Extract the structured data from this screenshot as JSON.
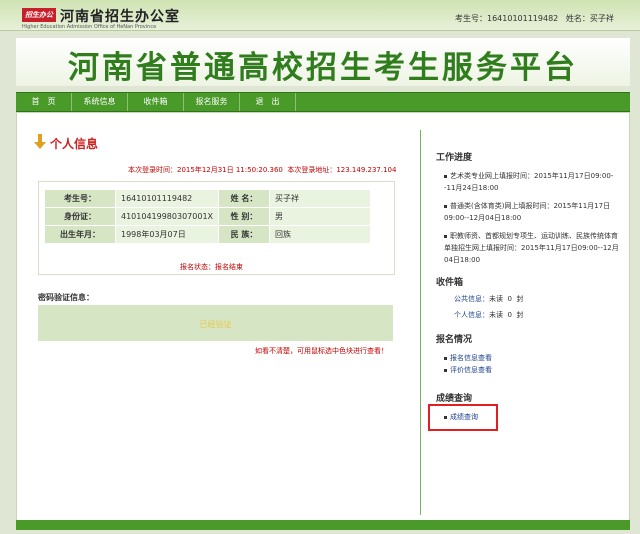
{
  "header": {
    "logo_text": "招生办公",
    "org_name": "河南省招生办公室",
    "org_name_en": "Higher Education Admission Office of HeNan Province",
    "exam_no_label": "考生号：",
    "exam_no": "16410101119482",
    "name_label": "姓名：",
    "name": "买子祥"
  },
  "banner": {
    "title": "河南省普通高校招生考生服务平台"
  },
  "nav": {
    "items": [
      "首　页",
      "系统信息",
      "收件箱",
      "报名服务",
      "退　出"
    ]
  },
  "main": {
    "section_title": "个人信息",
    "last_login_time_label": "本次登录时间：",
    "last_login_time": "2015年12月31日 11:50:20.360",
    "last_login_addr_label": "本次登录地址：",
    "last_login_addr": "123.149.237.104",
    "profile": {
      "exam_no_label": "考生号：",
      "exam_no": "16410101119482",
      "name_label": "姓 名：",
      "name": "买子祥",
      "id_label": "身份证：",
      "id": "41010419980307001X",
      "gender_label": "性 别：",
      "gender": "男",
      "birth_label": "出生年月：",
      "birth": "1998年03月07日",
      "ethnic_label": "民 族：",
      "ethnic": "回族"
    },
    "reg_status": "报名状态：报名结束",
    "pwd_label": "密码验证信息：",
    "pwd_text": "已经验证",
    "pwd_hint": "如看不清楚，可用鼠标选中色块进行查看！"
  },
  "sidebar": {
    "progress_title": "工作进度",
    "progress_items": [
      "艺术类专业网上填报时间：2015年11月17日09:00--11月24日18:00",
      "普通类(含体育类)网上填报时间：2015年11月17日09:00--12月04日18:00",
      "职教师资、首都规划专项生、运动训练、民族传统体育单独招生网上填报时间：2015年11月17日09:00--12月04日18:00"
    ],
    "inbox_title": "收件箱",
    "inbox_rows": [
      {
        "label": "公共信息：",
        "status": "未读",
        "count": "0",
        "unit": "封"
      },
      {
        "label": "个人信息：",
        "status": "未读",
        "count": "0",
        "unit": "封"
      }
    ],
    "reg_title": "报名情况",
    "reg_links": [
      "报名信息查看",
      "评价信息查看"
    ],
    "score_title": "成绩查询",
    "score_link": "成绩查询"
  },
  "colors": {
    "brand_green": "#2f7d1c",
    "nav_green": "#4a9a2a",
    "alert_red": "#c00000",
    "highlight_red": "#e02020"
  }
}
